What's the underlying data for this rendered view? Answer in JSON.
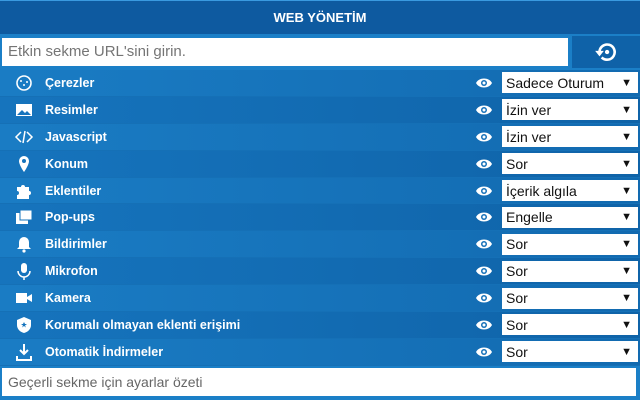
{
  "header": {
    "title": "WEB YÖNETİM"
  },
  "url_input": {
    "placeholder": "Etkin sekme URL'sini girin."
  },
  "settings": [
    {
      "icon": "cookie-icon",
      "label": "Çerezler",
      "value": "Sadece Oturum"
    },
    {
      "icon": "image-icon",
      "label": "Resimler",
      "value": "İzin ver"
    },
    {
      "icon": "code-icon",
      "label": "Javascript",
      "value": "İzin ver"
    },
    {
      "icon": "location-pin-icon",
      "label": "Konum",
      "value": "Sor"
    },
    {
      "icon": "puzzle-icon",
      "label": "Eklentiler",
      "value": "İçerik algıla"
    },
    {
      "icon": "popup-icon",
      "label": "Pop-ups",
      "value": "Engelle"
    },
    {
      "icon": "bell-icon",
      "label": "Bildirimler",
      "value": "Sor"
    },
    {
      "icon": "microphone-icon",
      "label": "Mikrofon",
      "value": "Sor"
    },
    {
      "icon": "camera-icon",
      "label": "Kamera",
      "value": "Sor"
    },
    {
      "icon": "shield-icon",
      "label": "Korumalı olmayan eklenti erişimi",
      "value": "Sor"
    },
    {
      "icon": "download-icon",
      "label": "Otomatik İndirmeler",
      "value": "Sor"
    }
  ],
  "footer": {
    "placeholder": "Geçerli sekme için ayarlar özeti"
  }
}
